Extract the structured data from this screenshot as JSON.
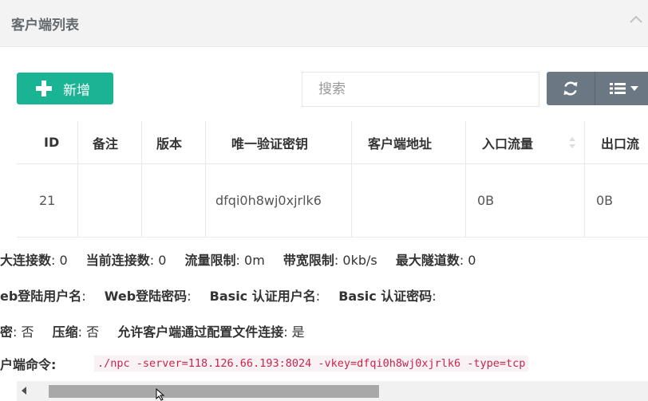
{
  "panel": {
    "title": "客户端列表"
  },
  "toolbar": {
    "add_label": "新增",
    "search_placeholder": "搜索"
  },
  "table": {
    "columns": [
      "ID",
      "备注",
      "版本",
      "唯一验证密钥",
      "客户端地址",
      "入口流量",
      "出口流"
    ],
    "row": {
      "id": "21",
      "remark": "",
      "version": "",
      "vkey": "dfqi0h8wj0xjrlk6",
      "addr": "",
      "in_flow": "0B",
      "out_flow": "0B"
    }
  },
  "details": {
    "line1": [
      {
        "label": "大连接数",
        "value": ": 0"
      },
      {
        "label": "当前连接数",
        "value": ": 0"
      },
      {
        "label": "流量限制",
        "value": ": 0m"
      },
      {
        "label": "带宽限制",
        "value": ": 0kb/s"
      },
      {
        "label": "最大隧道数",
        "value": ": 0"
      }
    ],
    "line2": [
      {
        "label": "eb登陆用户名",
        "value": ":"
      },
      {
        "label": "Web登陆密码",
        "value": ":"
      },
      {
        "label": "Basic 认证用户名",
        "value": ":"
      },
      {
        "label": "Basic 认证密码",
        "value": ":"
      }
    ],
    "line3": [
      {
        "label": "密",
        "value": ": 否"
      },
      {
        "label": "压缩",
        "value": ": 否"
      },
      {
        "label": "允许客户端通过配置文件连接",
        "value": ": 是"
      }
    ],
    "cmd_label": "户端命令:",
    "cmd": "./npc -server=118.126.66.193:8024 -vkey=dfqi0h8wj0xjrlk6 -type=tcp"
  },
  "colors": {
    "primary": "#1ab394",
    "tool_bg": "#6c7784",
    "code": "#c7254e"
  }
}
